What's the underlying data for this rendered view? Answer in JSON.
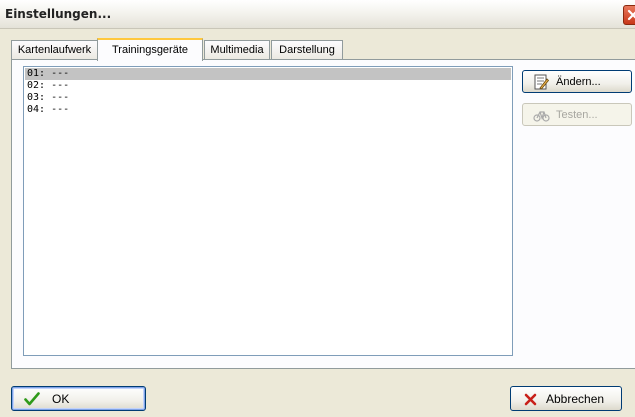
{
  "window": {
    "title": "Einstellungen..."
  },
  "tabs": [
    {
      "label": "Kartenlaufwerk",
      "active": false
    },
    {
      "label": "Trainingsgeräte",
      "active": true
    },
    {
      "label": "Multimedia",
      "active": false
    },
    {
      "label": "Darstellung",
      "active": false
    }
  ],
  "devices": {
    "items": [
      "01: ---",
      "02: ---",
      "03: ---",
      "04: ---"
    ],
    "selected_index": 0
  },
  "actions": {
    "change_label": "Ändern...",
    "test_label": "Testen...",
    "test_enabled": false
  },
  "footer": {
    "ok_label": "OK",
    "cancel_label": "Abbrechen"
  },
  "icons": {
    "change": "edit-document-icon",
    "test": "bike-icon",
    "ok": "checkmark-icon",
    "cancel": "x-mark-icon",
    "close": "close-icon"
  },
  "colors": {
    "active_tab_accent": "#ffc83c",
    "selection": "#c3c3c3",
    "ok_check": "#2f9a1a",
    "cancel_x": "#c8201a"
  }
}
